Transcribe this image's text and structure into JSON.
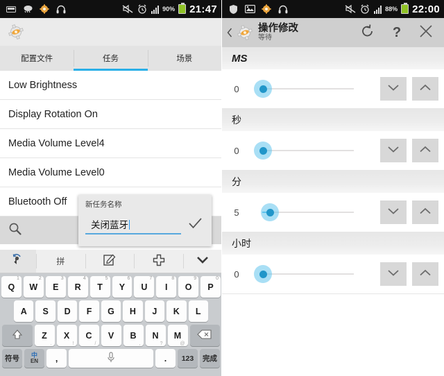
{
  "left": {
    "statusbar": {
      "icons": [
        "sd-card-icon",
        "cloud-icon",
        "settings-gear-icon",
        "headphones-icon"
      ],
      "right_icons": [
        "mute-icon",
        "alarm-icon",
        "signal-icon"
      ],
      "battery_pct": "90%",
      "clock": "21:47"
    },
    "app": {
      "icon": "app-gear-icon"
    },
    "tabs": [
      {
        "label": "配置文件",
        "active": false
      },
      {
        "label": "任务",
        "active": true
      },
      {
        "label": "场景",
        "active": false
      }
    ],
    "list": [
      {
        "label": "Low Brightness"
      },
      {
        "label": "Display Rotation On"
      },
      {
        "label": "Media Volume Level4"
      },
      {
        "label": "Media Volume Level0"
      },
      {
        "label": "Bluetooth Off"
      }
    ],
    "search": {
      "icon": "search-icon"
    },
    "dialog": {
      "title": "新任务名称",
      "value": "关闭蓝牙",
      "confirm_icon": "check-icon"
    },
    "keyboard": {
      "toolbar": [
        {
          "icon": "handwriting-icon",
          "label": ""
        },
        {
          "icon": "pinyin-icon",
          "label": "拼"
        },
        {
          "icon": "edit-pen-icon",
          "label": ""
        },
        {
          "icon": "plus-icon",
          "label": ""
        },
        {
          "icon": "chevron-down-icon",
          "label": ""
        }
      ],
      "row1": [
        {
          "key": "Q",
          "hint": "1"
        },
        {
          "key": "W",
          "hint": "2"
        },
        {
          "key": "E",
          "hint": "3"
        },
        {
          "key": "R",
          "hint": "4"
        },
        {
          "key": "T",
          "hint": "5"
        },
        {
          "key": "Y",
          "hint": "6"
        },
        {
          "key": "U",
          "hint": "7"
        },
        {
          "key": "I",
          "hint": "8"
        },
        {
          "key": "O",
          "hint": "9"
        },
        {
          "key": "P",
          "hint": "0"
        }
      ],
      "row2": [
        {
          "key": "A"
        },
        {
          "key": "S"
        },
        {
          "key": "D"
        },
        {
          "key": "F"
        },
        {
          "key": "G"
        },
        {
          "key": "H"
        },
        {
          "key": "J"
        },
        {
          "key": "K"
        },
        {
          "key": "L"
        }
      ],
      "row3": [
        {
          "key": "Z",
          "hint_b": "."
        },
        {
          "key": "X",
          "hint_b": "!"
        },
        {
          "key": "C",
          "hint_b": "/"
        },
        {
          "key": "V",
          "hint_b": ""
        },
        {
          "key": "B",
          "hint_b": ","
        },
        {
          "key": "N",
          "hint_b": "?"
        },
        {
          "key": "M",
          "hint_b": "@"
        }
      ],
      "shift_icon": "shift-icon",
      "backspace_icon": "backspace-icon",
      "row4": {
        "symbols": "符号",
        "lang_top": "中",
        "lang_bottom": "EN",
        "comma": ",",
        "space_icon": "mic-icon",
        "period": ".",
        "numbers": "123",
        "done": "完成"
      }
    }
  },
  "right": {
    "statusbar": {
      "icons": [
        "shield-icon",
        "photo-icon",
        "settings-gear-icon",
        "headphones-icon"
      ],
      "right_icons": [
        "mute-icon",
        "alarm-icon",
        "signal-icon"
      ],
      "battery_pct": "88%",
      "clock": "22:00"
    },
    "header": {
      "back_icon": "chevron-left-icon",
      "app_icon": "app-gear-icon",
      "title": "操作修改",
      "subtitle": "等待",
      "reset_icon": "reset-icon",
      "help_label": "?",
      "close_icon": "close-icon"
    },
    "sections": [
      {
        "name": "MS",
        "italic": true,
        "value": "0",
        "fill_pct": 0,
        "down_icon": "chevron-down-icon",
        "up_icon": "chevron-up-icon"
      },
      {
        "name": "秒",
        "italic": false,
        "value": "0",
        "fill_pct": 0,
        "down_icon": "chevron-down-icon",
        "up_icon": "chevron-up-icon"
      },
      {
        "name": "分",
        "italic": false,
        "value": "5",
        "fill_pct": 8,
        "down_icon": "chevron-down-icon",
        "up_icon": "chevron-up-icon"
      },
      {
        "name": "小时",
        "italic": false,
        "value": "0",
        "fill_pct": 0,
        "down_icon": "chevron-down-icon",
        "up_icon": "chevron-up-icon"
      }
    ]
  }
}
